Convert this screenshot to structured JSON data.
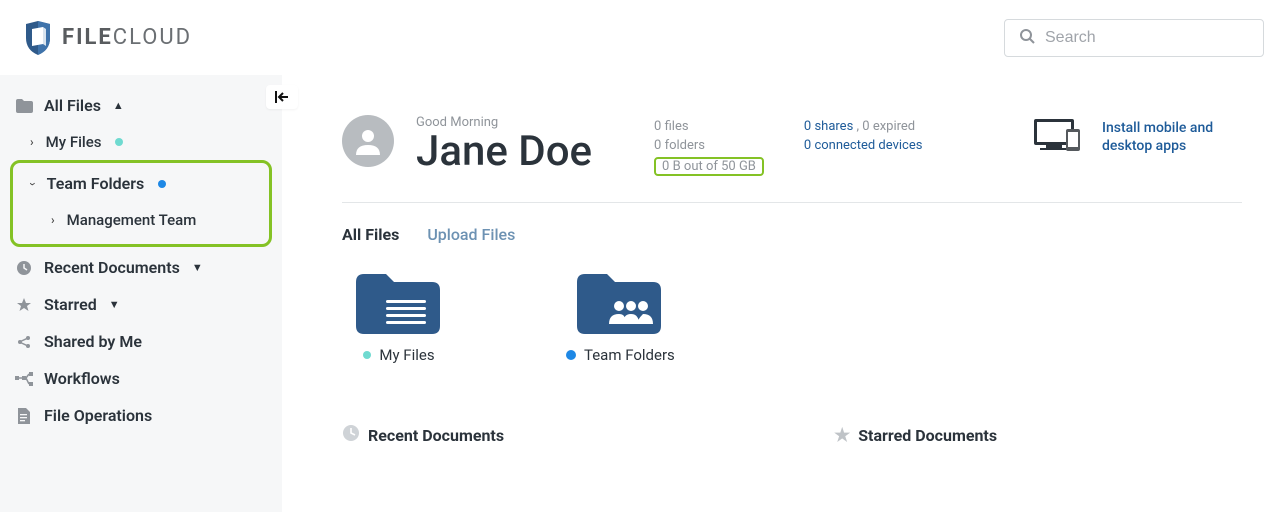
{
  "brand": {
    "name": "FILECLOUD",
    "strong": "FILE",
    "light": "CLOUD"
  },
  "search": {
    "placeholder": "Search"
  },
  "sidebar": {
    "allFiles": "All Files",
    "myFiles": "My Files",
    "teamFolders": "Team Folders",
    "managementTeam": "Management Team",
    "recentDocs": "Recent Documents",
    "starred": "Starred",
    "sharedByMe": "Shared by Me",
    "workflows": "Workflows",
    "fileOps": "File Operations"
  },
  "hero": {
    "greeting": "Good Morning",
    "username": "Jane Doe",
    "files": "0 files",
    "folders": "0 folders",
    "storage": "0 B out of 50 GB",
    "sharesA": "0 shares",
    "sharesB": ", 0 expired",
    "devices": "0 connected devices",
    "install": "Install mobile and desktop apps"
  },
  "tabs": {
    "all": "All Files",
    "upload": "Upload Files"
  },
  "tiles": {
    "myFiles": "My Files",
    "teamFolders": "Team Folders"
  },
  "sections": {
    "recent": "Recent Documents",
    "starred": "Starred Documents"
  }
}
